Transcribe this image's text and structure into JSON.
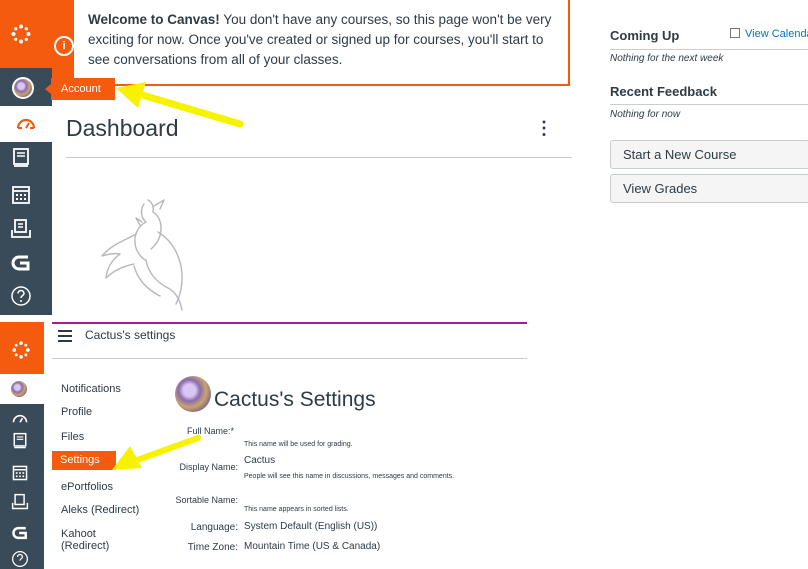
{
  "top_panel": {
    "notice": {
      "icon": "info-icon",
      "bold": "Welcome to Canvas!",
      "text": " You don't have any courses, so this page won't be very exciting for now. Once you've created or signed up for courses, you'll start to see conversations from all of your classes."
    },
    "account_tooltip": "Account",
    "dashboard_title": "Dashboard",
    "dashboard_menu": "⋮",
    "sidebar": {
      "coming_up": "Coming Up",
      "view_calendar": "View Calenda",
      "nothing_next_week": "Nothing for the next week",
      "recent_feedback": "Recent Feedback",
      "nothing_for_now": "Nothing for now",
      "start_course": "Start a New Course",
      "view_grades": "View Grades"
    }
  },
  "bottom_panel": {
    "breadcrumb": "Cactus's settings",
    "subnav": [
      "Notifications",
      "Profile",
      "Files",
      "Settings",
      "ePortfolios",
      "Aleks (Redirect)",
      "Kahoot (Redirect)"
    ],
    "settings_title": "Cactus's Settings",
    "fields": {
      "full_name_label": "Full Name:*",
      "full_name_hint": "This name will be used for grading.",
      "display_name_label": "Display Name:",
      "display_name_value": "Cactus",
      "display_name_hint": "People will see this name in discussions, messages and comments.",
      "sortable_name_label": "Sortable Name:",
      "sortable_name_hint": "This name appears in sorted lists.",
      "language_label": "Language:",
      "language_value": "System Default (English (US))",
      "timezone_label": "Time Zone:",
      "timezone_value": "Mountain Time (US & Canada)"
    }
  },
  "colors": {
    "brand": "#f45b0e",
    "nav": "#394b58",
    "link": "#0374b5",
    "arrow": "#f6f200"
  }
}
